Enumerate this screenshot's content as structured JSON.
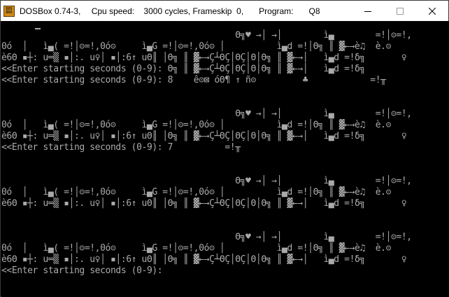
{
  "window": {
    "app_name": "DOSBox 0.74-3",
    "stats": "Cpu speed:    3000 cycles, Frameskip  0,",
    "program_label": "Program:",
    "program_name": "Q8",
    "icon_text_top": "DOS",
    "icon_text_bottom": "BOX",
    "minimize_icon": "minimize-icon",
    "maximize_icon": "maximize-icon",
    "close_icon": "close-icon"
  },
  "screen": {
    "text_color": "#aaaaaa",
    "background": "#000000",
    "lines": [
      "                                             Θ╗♥ →│ →│        ì▄        =!│⊝=!,",
      "0ó  │   ì▄( =!│⊝=!,0ó⊝     ì▄G =!│⊝=!,0ó⊝ │          ì▄d =!│Θ╗ ║ ▓←→è♫  è.⊝",
      "è6Θ ▪┼: u═▒ ▪│:. u♀│ ▪│:6↑ uΘ║ │Θ╗ ║ ▓←→Ç┴ΘÇ│ΘÇ│Θ│Θ╗ ║ ▓←→│   ì▄d =!δ╗       ♀",
      "<<Enter starting seconds (0-9): Θ╗ ║ ▓←→Ç┴ΘÇ│ΘÇ│Θ│Θ╗ ║ ▓←→│   ì▄d =!δ╗",
      "<<Enter starting seconds (0-9): 8    ê⊝⊠ óΘ¶ ↑ ñ⊝         ♣            =!╥",
      "",
      "",
      "                                             Θ╗♥ →│ →│        ì▄        =!│⊝=!,",
      "0ó  │   ì▄( =!│⊝=!,0ó⊝     ì▄G =!│⊝=!,0ó⊝ │          ì▄d =!│Θ╗ ║ ▓←→è♫  è.⊝",
      "è6Θ ▪┼: u═▒ ▪│:. u♀│ ▪│:6↑ uΘ║ │Θ╗ ║ ▓←→Ç┴ΘÇ│ΘÇ│Θ│Θ╗ ║ ▓←→│   ì▄d =!δ╗       ♀",
      "<<Enter starting seconds (0-9): 7          =!╥",
      "",
      "",
      "                                             Θ╗♥ →│ →│        ì▄        =!│⊝=!,",
      "0ó  │   ì▄( =!│⊝=!,0ó⊝     ì▄G =!│⊝=!,0ó⊝ │          ì▄d =!│Θ╗ ║ ▓←→è♫  è.⊝",
      "è6Θ ▪┼: u═▒ ▪│:. u♀│ ▪│:6↑ uΘ║ │Θ╗ ║ ▓←→Ç┴ΘÇ│ΘÇ│Θ│Θ╗ ║ ▓←→│   ì▄d =!δ╗       ♀",
      "",
      "",
      "                                             Θ╗♥ →│ →│        ì▄        =!│⊝=!,",
      "0ó  │   ì▄( =!│⊝=!,0ó⊝     ì▄G =!│⊝=!,0ó⊝ │          ì▄d =!│Θ╗ ║ ▓←→è♫  è.⊝",
      "è6Θ ▪┼: u═▒ ▪│:. u♀│ ▪│:6↑ uΘ║ │Θ╗ ║ ▓←→Ç┴ΘÇ│ΘÇ│Θ│Θ╗ ║ ▓←→│   ì▄d =!δ╗       ♀",
      "<<Enter starting seconds (0-9):"
    ]
  }
}
